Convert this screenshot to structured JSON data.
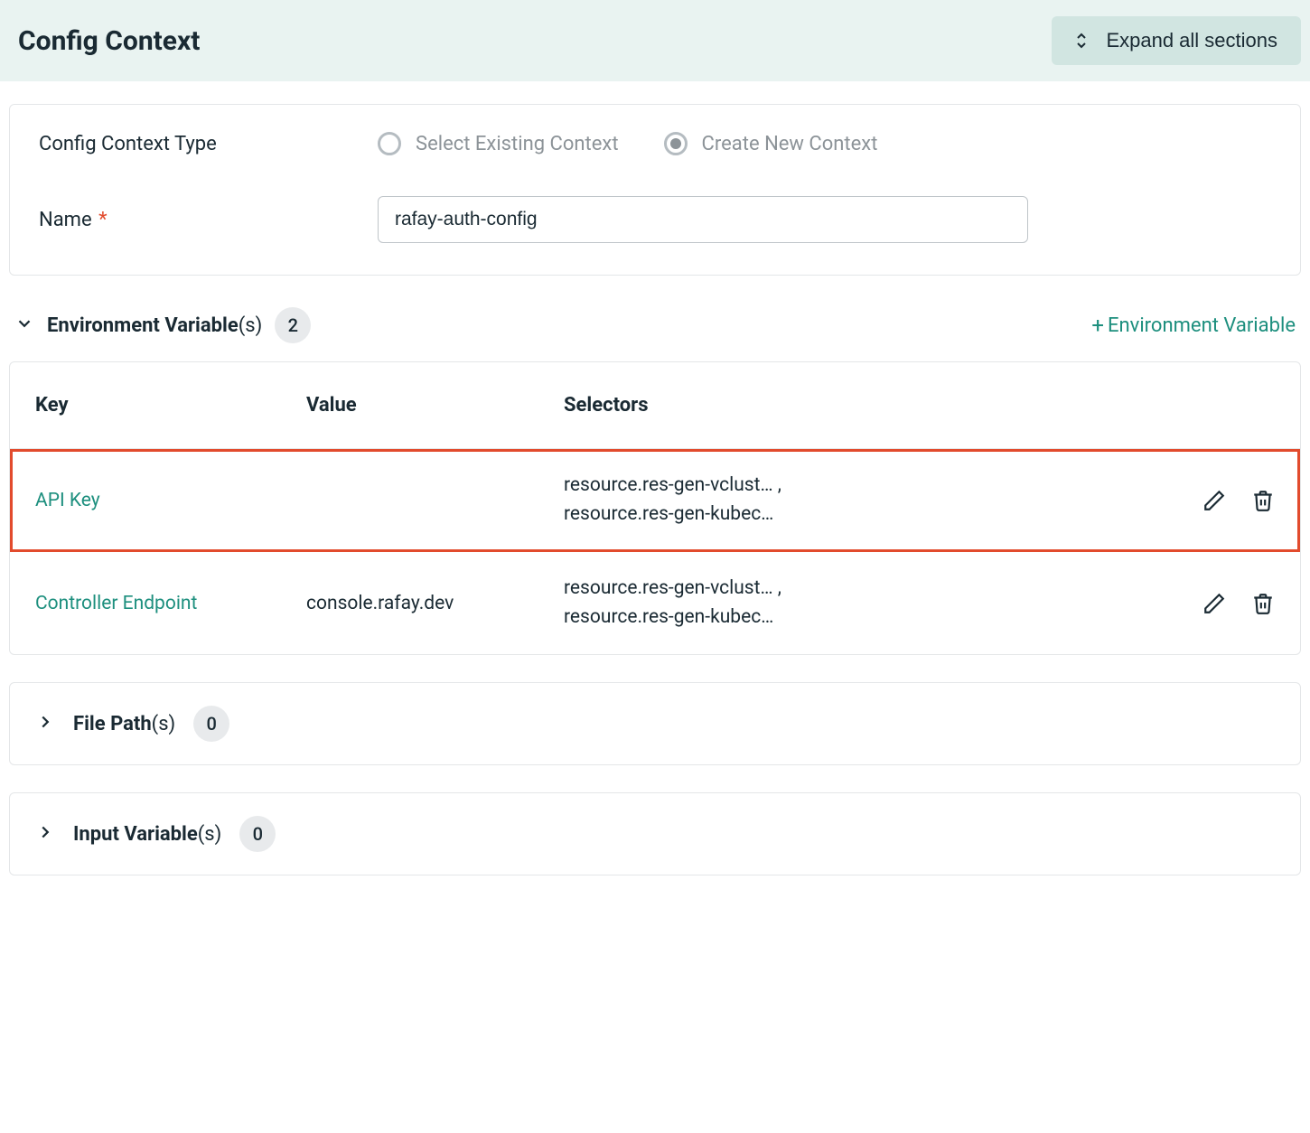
{
  "header": {
    "title": "Config Context",
    "expand_label": "Expand all sections"
  },
  "form": {
    "type_label": "Config Context Type",
    "radio_existing": "Select Existing Context",
    "radio_new": "Create New Context",
    "selected_radio": "new",
    "name_label": "Name",
    "name_required": "*",
    "name_value": "rafay-auth-config"
  },
  "env_section": {
    "title_bold": "Environment Variable",
    "title_suffix": "(s)",
    "count": "2",
    "add_label": "Environment Variable",
    "columns": {
      "key": "Key",
      "value": "Value",
      "selectors": "Selectors"
    },
    "rows": [
      {
        "key": "API Key",
        "value": "",
        "sel1": "resource.res-gen-vclust… ,",
        "sel2": "resource.res-gen-kubec…",
        "highlight": true
      },
      {
        "key": "Controller Endpoint",
        "value": "console.rafay.dev",
        "sel1": "resource.res-gen-vclust… ,",
        "sel2": "resource.res-gen-kubec…",
        "highlight": false
      }
    ]
  },
  "file_section": {
    "title_bold": "File Path",
    "title_suffix": "(s)",
    "count": "0"
  },
  "input_section": {
    "title_bold": "Input Variable",
    "title_suffix": "(s)",
    "count": "0"
  }
}
